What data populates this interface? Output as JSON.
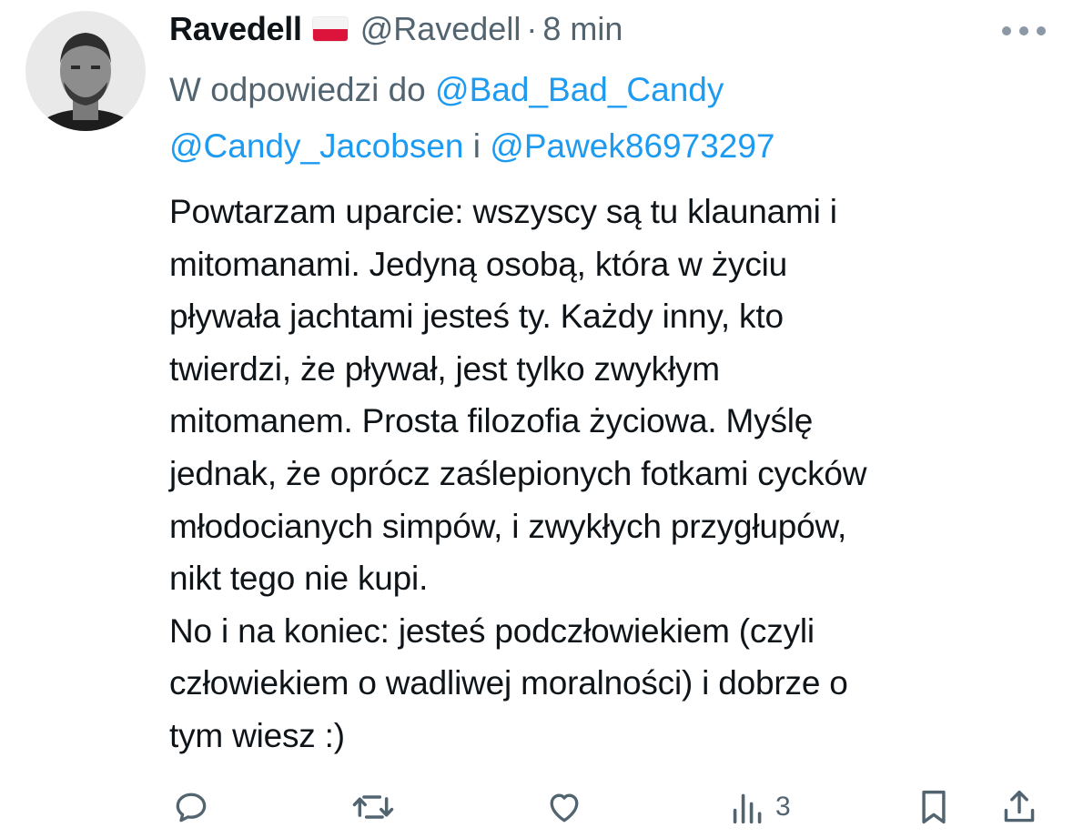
{
  "tweet": {
    "display_name": "Ravedell",
    "flag_icon": "poland-flag-icon",
    "handle": "@Ravedell",
    "separator": "·",
    "time": "8 min",
    "more_icon": "more-options-icon",
    "reply_prefix": "W odpowiedzi do ",
    "mention_1": "@Bad_Bad_Candy",
    "mention_2": "@Candy_Jacobsen",
    "reply_join": " i ",
    "mention_3": "@Pawek86973297",
    "text": "Powtarzam uparcie: wszyscy są tu klaunami i\nmitomanami. Jedyną osobą, która w życiu\npływała jachtami jesteś ty. Każdy inny, kto\ntwierdzi, że pływał, jest tylko zwykłym\nmitomanem. Prosta filozofia życiowa. Myślę\njednak, że oprócz zaślepionych fotkami cycków\nmłodocianych simpów, i zwykłych przygłupów,\nnikt tego nie kupi.\nNo i na koniec: jesteś podczłowiekiem (czyli\nczłowiekiem o wadliwej moralności) i dobrze o\ntym wiesz :)"
  },
  "actions": {
    "reply_icon": "reply-icon",
    "retweet_icon": "retweet-icon",
    "like_icon": "like-icon",
    "views_icon": "views-icon",
    "views_count": "3",
    "bookmark_icon": "bookmark-icon",
    "share_icon": "share-icon"
  },
  "colors": {
    "text": "#0f1419",
    "secondary": "#536471",
    "link": "#1d9bf0",
    "background": "#ffffff"
  }
}
